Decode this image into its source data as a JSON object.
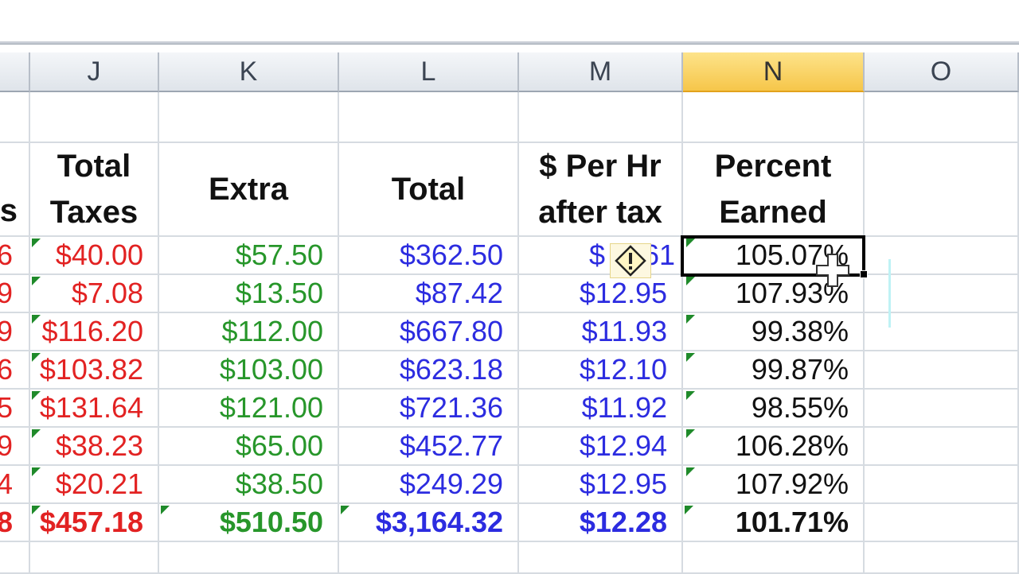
{
  "columns": [
    {
      "id": "partial",
      "letter": ""
    },
    {
      "id": "J",
      "letter": "J"
    },
    {
      "id": "K",
      "letter": "K"
    },
    {
      "id": "L",
      "letter": "L"
    },
    {
      "id": "M",
      "letter": "M"
    },
    {
      "id": "N",
      "letter": "N"
    },
    {
      "id": "O",
      "letter": "O"
    }
  ],
  "header_row": {
    "partial": "s",
    "J_line1": "Total",
    "J_line2": "Taxes",
    "K": "Extra",
    "L": "Total",
    "M_line1": "$ Per Hr",
    "M_line2": "after tax",
    "N_line1": "Percent",
    "N_line2": "Earned"
  },
  "rows": [
    {
      "partial": "6",
      "J": "$40.00",
      "K": "$57.50",
      "L": "$362.50",
      "M": "$",
      "M_tail": "61",
      "N": "105.07%"
    },
    {
      "partial": "9",
      "J": "$7.08",
      "K": "$13.50",
      "L": "$87.42",
      "M": "$12.95",
      "N": "107.93%"
    },
    {
      "partial": "9",
      "J": "$116.20",
      "K": "$112.00",
      "L": "$667.80",
      "M": "$11.93",
      "N": "99.38%"
    },
    {
      "partial": "6",
      "J": "$103.82",
      "K": "$103.00",
      "L": "$623.18",
      "M": "$12.10",
      "N": "99.87%"
    },
    {
      "partial": "5",
      "J": "$131.64",
      "K": "$121.00",
      "L": "$721.36",
      "M": "$11.92",
      "N": "98.55%"
    },
    {
      "partial": "9",
      "J": "$38.23",
      "K": "$65.00",
      "L": "$452.77",
      "M": "$12.94",
      "N": "106.28%"
    },
    {
      "partial": "4",
      "J": "$20.21",
      "K": "$38.50",
      "L": "$249.29",
      "M": "$12.95",
      "N": "107.92%"
    }
  ],
  "totals_row": {
    "partial": "8",
    "J": "$457.18",
    "K": "$510.50",
    "L": "$3,164.32",
    "M": "$12.28",
    "N": "101.71%"
  },
  "selected_column": "N",
  "selected_cell": "N",
  "colors": {
    "taxes": "#e22222",
    "extra": "#27962a",
    "total": "#2c2ce0",
    "percent": "#111111",
    "selection": "#f6c64a"
  },
  "icons": {
    "error_indicator": "warning-diamond-icon",
    "cursor": "cross-cursor-icon"
  }
}
